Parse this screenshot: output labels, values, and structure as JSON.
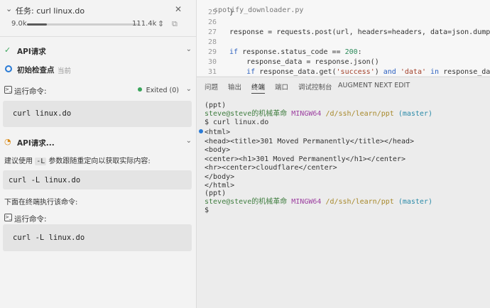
{
  "task": {
    "title": "任务: curl linux.do",
    "tokens_low": "9.0k",
    "tokens_high": "111.4k",
    "progress": 0.18
  },
  "sections": {
    "api_request": "API请求",
    "initial_checkpoint": "初始检查点",
    "checkpoint_sub": "当前",
    "run_command": "运行命令:",
    "command_status": "Exited (0)",
    "command1": "curl linux.do",
    "api_request_pending": "API请求...",
    "suggestion_pre": "建议使用",
    "suggestion_flag": "-L",
    "suggestion_post": "参数跟随重定向以获取实际内容:",
    "command2": "curl -L linux.do",
    "execute_text": "下面在终端执行该命令:",
    "run_command2": "运行命令:",
    "command3": "curl -L linux.do"
  },
  "editor": {
    "tab_label": "spotify_downloader.py",
    "lines": [
      {
        "num": "25",
        "code": "}"
      },
      {
        "num": "26",
        "code": ""
      },
      {
        "num": "27",
        "code": "response = requests.post(url, headers=headers, data=json.dumps(data))"
      },
      {
        "num": "28",
        "code": ""
      },
      {
        "num": "29",
        "code": "if response.status_code == 200:"
      },
      {
        "num": "30",
        "code": "    response_data = response.json()"
      },
      {
        "num": "31",
        "code": "    if response_data.get('success') and 'data' in response_data:"
      }
    ]
  },
  "panel_tabs": [
    "问题",
    "输出",
    "终端",
    "端口",
    "调试控制台",
    "AUGMENT NEXT EDIT"
  ],
  "active_panel_tab": "终端",
  "terminal": {
    "env": "(ppt)",
    "user": "steve@steve的机械革命",
    "shell": "MINGW64",
    "path": "/d/ssh/learn/ppt",
    "branch": "(master)",
    "command": "$ curl linux.do",
    "output": [
      "<html>",
      "<head><title>301 Moved Permanently</title></head>",
      "<body>",
      "<center><h1>301 Moved Permanently</h1></center>",
      "<hr><center>cloudflare</center>",
      "</body>",
      "</html>"
    ],
    "env2": "(ppt)",
    "prompt": "$"
  },
  "colors": {
    "accent": "#2a7bd6",
    "status_green": "#3aa55b",
    "term_user": "#3f7d3f",
    "term_shell": "#9d41a1",
    "term_path": "#a7882a",
    "term_branch": "#2a8aa8"
  }
}
